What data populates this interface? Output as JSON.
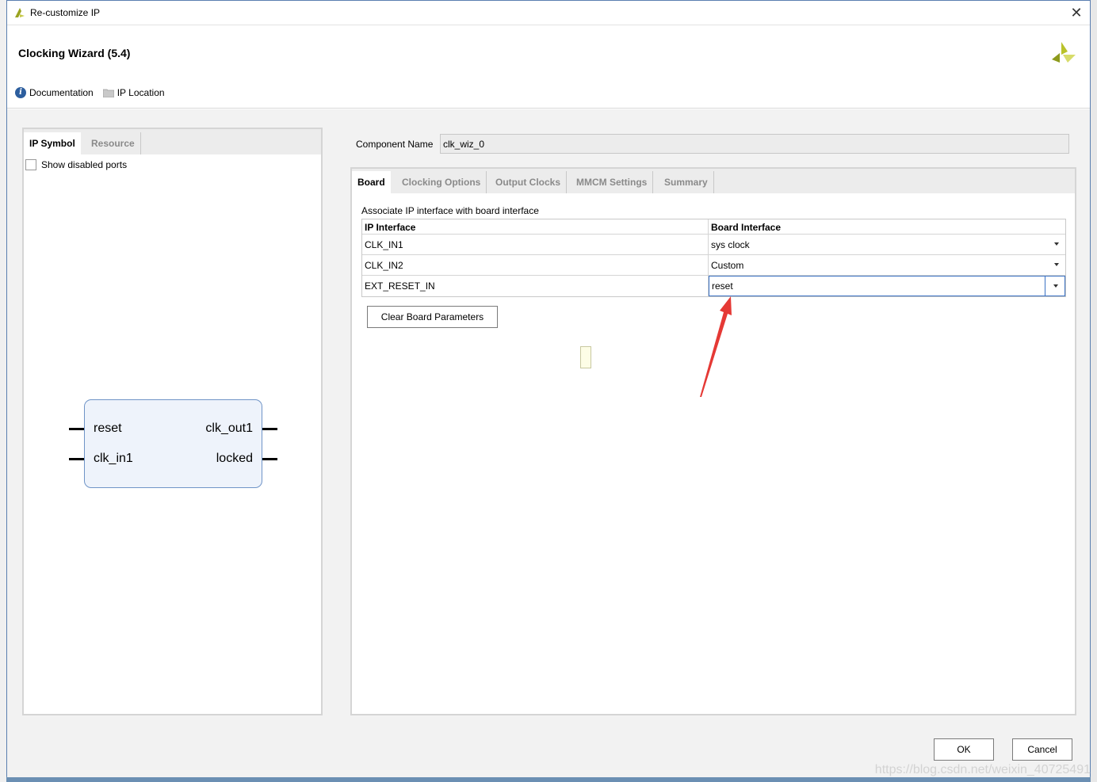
{
  "window": {
    "title": "Re-customize IP",
    "close_glyph": "✕"
  },
  "header": {
    "title": "Clocking Wizard (5.4)",
    "links": [
      {
        "label": "Documentation",
        "icon": "info-icon"
      },
      {
        "label": "IP Location",
        "icon": "folder-icon"
      }
    ]
  },
  "left_panel": {
    "tabs": [
      {
        "label": "IP Symbol",
        "active": true
      },
      {
        "label": "Resource",
        "active": false
      }
    ],
    "show_disabled_ports": {
      "label": "Show disabled ports",
      "checked": false
    },
    "symbol": {
      "left_pins": [
        "reset",
        "clk_in1"
      ],
      "right_pins": [
        "clk_out1",
        "locked"
      ]
    }
  },
  "component": {
    "label": "Component Name",
    "value": "clk_wiz_0"
  },
  "right_panel": {
    "tabs": [
      {
        "label": "Board",
        "active": true
      },
      {
        "label": "Clocking Options",
        "active": false
      },
      {
        "label": "Output Clocks",
        "active": false
      },
      {
        "label": "MMCM Settings",
        "active": false
      },
      {
        "label": "Summary",
        "active": false
      }
    ],
    "assoc_label": "Associate IP interface with board interface",
    "table": {
      "headers": [
        "IP Interface",
        "Board Interface"
      ],
      "rows": [
        {
          "ip": "CLK_IN1",
          "board": "sys clock"
        },
        {
          "ip": "CLK_IN2",
          "board": "Custom"
        },
        {
          "ip": "EXT_RESET_IN",
          "board": "reset"
        }
      ]
    },
    "clear_button": "Clear Board Parameters"
  },
  "footer": {
    "ok": "OK",
    "cancel": "Cancel"
  },
  "watermark": "https://blog.csdn.net/weixin_40725491",
  "colors": {
    "accent": "#3b72c4",
    "annotation_arrow": "#e53935"
  }
}
